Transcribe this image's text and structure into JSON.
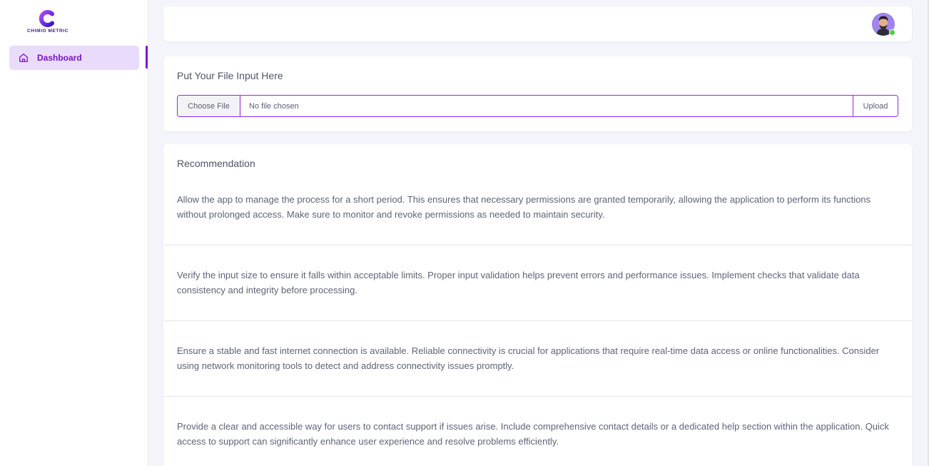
{
  "brand": {
    "name": "CHIMIO METRIC",
    "accent": "#7a1ad0"
  },
  "sidebar": {
    "items": [
      {
        "label": "Dashboard",
        "icon": "home-icon",
        "active": true
      }
    ]
  },
  "header": {
    "avatar": "user-avatar",
    "status": "online"
  },
  "upload": {
    "title": "Put Your File Input Here",
    "choose_label": "Choose File",
    "file_status": "No file chosen",
    "upload_label": "Upload"
  },
  "recommendation": {
    "title": "Recommendation",
    "items": [
      "Allow the app to manage the process for a short period. This ensures that necessary permissions are granted temporarily, allowing the application to perform its functions without prolonged access. Make sure to monitor and revoke permissions as needed to maintain security.",
      "Verify the input size to ensure it falls within acceptable limits. Proper input validation helps prevent errors and performance issues. Implement checks that validate data consistency and integrity before processing.",
      "Ensure a stable and fast internet connection is available. Reliable connectivity is crucial for applications that require real-time data access or online functionalities. Consider using network monitoring tools to detect and address connectivity issues promptly.",
      "Provide a clear and accessible way for users to contact support if issues arise. Include comprehensive contact details or a dedicated help section within the application. Quick access to support can significantly enhance user experience and resolve problems efficiently."
    ]
  }
}
